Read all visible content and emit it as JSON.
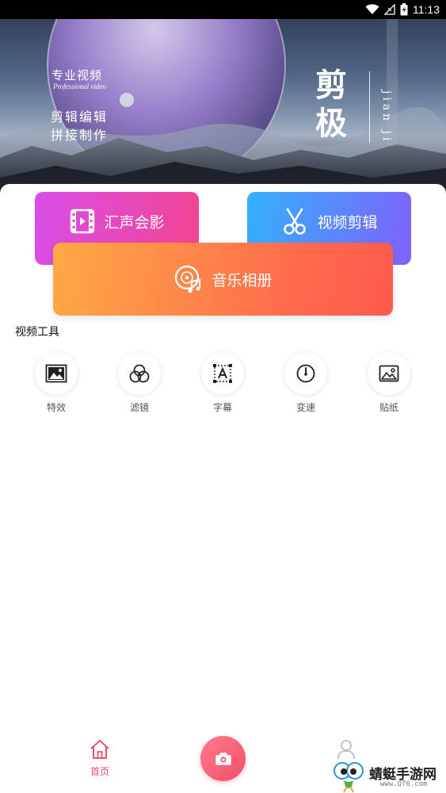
{
  "status_bar": {
    "time": "11:13",
    "icons": [
      "wifi-icon",
      "signal-icon",
      "battery-icon"
    ]
  },
  "banner": {
    "line_1": "专业视频",
    "line_1_en": "Professional video",
    "line_2": "剪辑编辑",
    "line_3": "拼接制作",
    "big_char_1": "剪",
    "big_char_2": "极",
    "pinyin": "jian ji"
  },
  "cards": [
    {
      "label": "汇声会影",
      "icon": "film-icon",
      "colors": [
        "#d84dea",
        "#f2458f"
      ]
    },
    {
      "label": "视频剪辑",
      "icon": "scissors-icon",
      "colors": [
        "#33b1fb",
        "#7e62fa"
      ]
    },
    {
      "label": "音乐相册",
      "icon": "music-disc-icon",
      "colors": [
        "#fdaa44",
        "#fd5a4d"
      ]
    }
  ],
  "tools_section": {
    "title": "视频工具",
    "items": [
      {
        "label": "特效",
        "icon": "effects-image-icon"
      },
      {
        "label": "滤镜",
        "icon": "filter-circles-icon"
      },
      {
        "label": "字幕",
        "icon": "subtitle-text-icon"
      },
      {
        "label": "变速",
        "icon": "speed-clock-icon"
      },
      {
        "label": "贴纸",
        "icon": "sticker-image-icon"
      }
    ]
  },
  "bottom_nav": {
    "home_label": "首页",
    "accent_color": "#f04e6b",
    "camera_icon": "camera-icon",
    "profile_icon": "user-icon"
  },
  "watermark": {
    "text": "蜻蜓手游网",
    "url": "www.QT6.com"
  }
}
